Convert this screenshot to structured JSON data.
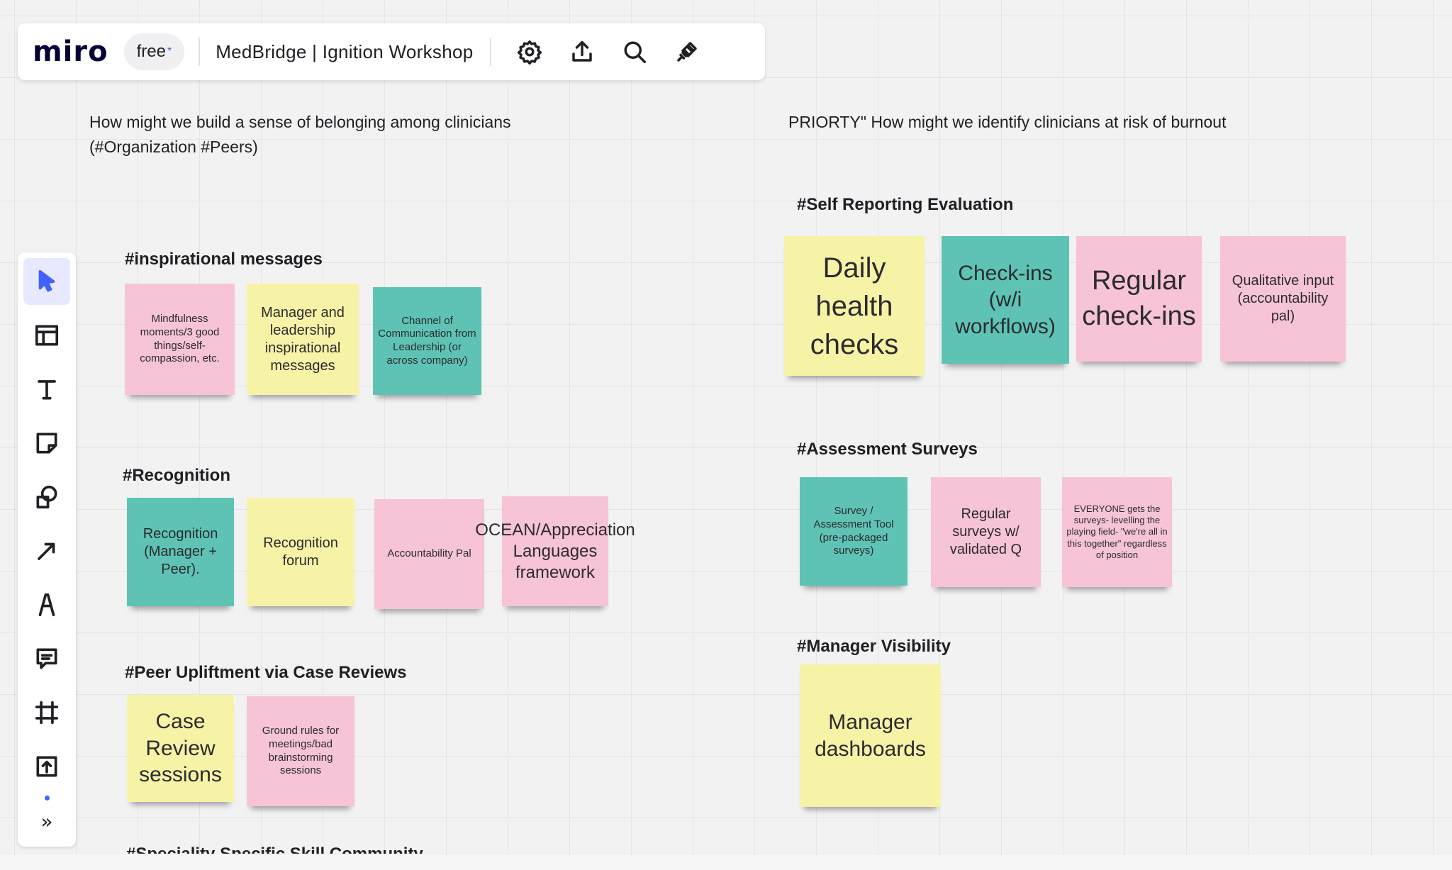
{
  "app": {
    "logo": "miro",
    "plan_badge": "free",
    "plan_mark": "*",
    "board_title": "MedBridge | Ignition Workshop"
  },
  "toolbar_icons": [
    "gear-icon",
    "upload-icon",
    "search-icon",
    "plug-icon"
  ],
  "tools": [
    "select-arrow-icon",
    "templates-icon",
    "text-icon",
    "sticky-note-icon",
    "shapes-icon",
    "connection-line-icon",
    "pen-icon",
    "comment-icon",
    "frame-icon",
    "upload-tool-icon"
  ],
  "more_label": "»",
  "left": {
    "title_line1": "How might we build a sense of belonging among clinicians",
    "title_line2": "(#Organization #Peers)",
    "sections": [
      {
        "heading": "#inspirational messages",
        "notes": [
          "Mindfulness moments/3 good things/self-compassion, etc.",
          "Manager and leadership inspirational messages",
          "Channel of Communication from Leadership (or across company)"
        ]
      },
      {
        "heading": "#Recognition",
        "notes": [
          "Recognition (Manager + Peer).",
          "Recognition forum",
          "Accountability Pal",
          "OCEAN/Appreciation Languages framework"
        ]
      },
      {
        "heading": "#Peer Upliftment via Case Reviews",
        "notes": [
          "Case Review sessions",
          "Ground rules for meetings/bad brainstorming sessions"
        ]
      },
      {
        "heading": "#Speciality Specific Skill Community"
      }
    ]
  },
  "right": {
    "title": "PRIORTY\" How might we identify clinicians at risk of burnout",
    "sections": [
      {
        "heading": "#Self Reporting Evaluation",
        "notes": [
          "Daily health checks",
          "Check-ins (w/i workflows)",
          "Regular check-ins",
          "Qualitative input (accountability pal)"
        ]
      },
      {
        "heading": "#Assessment Surveys",
        "notes": [
          "Survey / Assessment Tool (pre-packaged surveys)",
          "Regular surveys w/ validated Q",
          "EVERYONE gets the surveys- levelling the playing field- \"we're all in this together\" regardless of position"
        ]
      },
      {
        "heading": "#Manager Visibility",
        "notes": [
          "Manager dashboards"
        ]
      }
    ]
  },
  "colors": {
    "pink": "#f6c3d7",
    "yellow": "#f7f3a6",
    "teal": "#5ec3b4",
    "accent": "#4262ff"
  }
}
